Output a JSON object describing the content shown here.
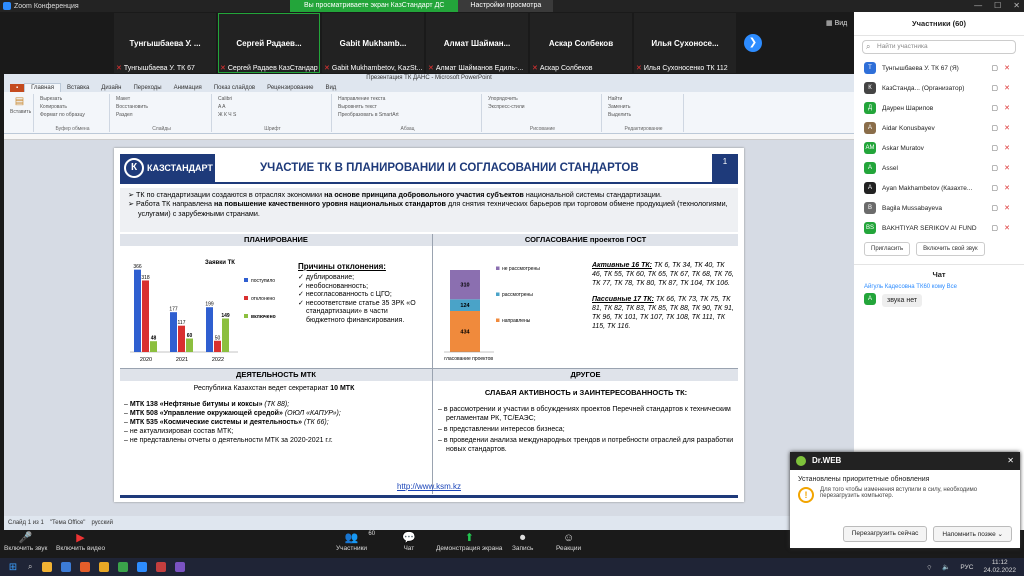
{
  "window": {
    "title": "Zoom Конференция",
    "share_banner": "Вы просматриваете экран КазСтандарт ДС",
    "view_options": "Настройки просмотра",
    "view_label": "Вид"
  },
  "strip": {
    "tiles": [
      {
        "name": "Тунгышбаева У. ...",
        "sub": "Тунгышбаева У. ТК 67"
      },
      {
        "name": "Сергей Радаев...",
        "sub": "Сергей Радаев КазСтандарт"
      },
      {
        "name": "Gabit Mukhamb...",
        "sub": "Gabit Mukhambetov, KazSt..."
      },
      {
        "name": "Алмат Шайман...",
        "sub": "Алмат Шайманов Едиль-..."
      },
      {
        "name": "Аскар Солбеков",
        "sub": "Аскар Солбеков"
      },
      {
        "name": "Илья Сухоносе...",
        "sub": "Илья Сухоносенко ТК 112"
      }
    ],
    "next_glyph": "❯"
  },
  "ppt": {
    "title": "Презентация ТК ДАНС - Microsoft PowerPoint",
    "tabs": [
      "Главная",
      "Вставка",
      "Дизайн",
      "Переходы",
      "Анимация",
      "Показ слайдов",
      "Рецензирование",
      "Вид"
    ],
    "groups": [
      {
        "label": "Буфер обмена",
        "items": [
          "Вырезать",
          "Копировать",
          "Формат по образцу"
        ]
      },
      {
        "label": "Слайды",
        "items": [
          "Макет",
          "Восстановить",
          "Раздел"
        ]
      },
      {
        "label": "Шрифт",
        "items": [
          "Calibri",
          "A A",
          "Ж К Ч S"
        ]
      },
      {
        "label": "Абзац",
        "items": [
          "Направление текста",
          "Выровнять текст",
          "Преобразовать в SmartArt"
        ]
      },
      {
        "label": "Рисование",
        "items": [
          "Упорядочить",
          "Экспресс-стили"
        ]
      },
      {
        "label": "Редактирование",
        "items": [
          "Найти",
          "Заменить",
          "Выделить"
        ]
      }
    ],
    "paste_label": "Вставить",
    "create_label": "Создать слайд",
    "status": [
      "Слайд 1 из 1",
      "\"Тема Office\"",
      "русский"
    ]
  },
  "slide": {
    "logo": "КАЗСТАНДАРТ",
    "logo_mark": "К",
    "title": "УЧАСТИЕ ТК В ПЛАНИРОВАНИИ И СОГЛАСОВАНИИ СТАНДАРТОВ",
    "num": "1",
    "intro": [
      {
        "a": "ТК по стандартизации создаются в отраслях экономики ",
        "b": "на основе принципа добровольного участия субъектов",
        "c": " национальной системы стандартизации."
      },
      {
        "a": "Работа ТК направлена ",
        "b": "на повышение качественного уровня национальных стандартов",
        "c": " для снятия технических барьеров при торговом обмене продукцией (технологиями, услугами) с зарубежными странами."
      }
    ],
    "plan_header": "ПЛАНИРОВАНИЕ",
    "gost_header": "СОГЛАСОВАНИЕ проектов ГОСТ",
    "mtk_header": "ДЕЯТЕЛЬНОСТЬ МТК",
    "other_header": "ДРУГОЕ",
    "reasons_title": "Причины отклонения:",
    "reasons": [
      "дублирование;",
      "необоснованность;",
      "несогласованность с ЦГО;",
      "несоответствие статье 35 ЗРК «О стандартизации» в части бюджетного финансирования."
    ],
    "active_title": "Активные 16 ТК:",
    "active_text": " ТК 6, ТК 34, ТК 40, ТК 46, ТК 55, ТК 60, ТК 65, ТК 67, ТК 68, ТК 76, ТК 77, ТК 78, ТК 80, ТК 87, ТК 104, ТК 106.",
    "passive_title": "Пассивные 17 ТК:",
    "passive_text": " ТК 66, ТК 73, ТК 75, ТК 81, ТК 82, ТК 83, ТК 85, ТК 88, ТК 90, ТК 91, ТК 96, ТК 101, ТК 107, ТК 108, ТК 111, ТК 115, ТК 116.",
    "mtk_intro": "Республика Казахстан ведет секретариат ",
    "mtk_intro_b": "10 МТК",
    "mtk_items": [
      {
        "b": "МТК 138 «Нефтяные битумы и коксы»",
        "i": " (ТК 88);"
      },
      {
        "b": "МТК 508 «Управление окружающей средой»",
        "i": " (ОЮЛ «КАПУР»);"
      },
      {
        "b": "МТК 535 «Космические системы и деятельность»",
        "i": " (ТК 66);"
      },
      {
        "b": "",
        "i": "не актуализирован состав МТК;"
      },
      {
        "b": "",
        "i": "не представлены отчеты о деятельности МТК за 2020-2021 г.г."
      }
    ],
    "other_title": "СЛАБАЯ АКТИВНОСТЬ и ЗАИНТЕРЕСОВАННОСТЬ ТК:",
    "other_items": [
      "в рассмотрении и участии в обсуждениях проектов Перечней стандартов к техническим регламентам РК, ТС/ЕАЭС;",
      "в представлении интересов бизнеса;",
      "в проведении анализа международных трендов и потребности отраслей для разработки новых стандартов."
    ],
    "link": "http://www.ksm.kz"
  },
  "chart_data": [
    {
      "type": "bar",
      "title": "Заявки ТК",
      "categories": [
        "2020",
        "2021",
        "2022"
      ],
      "series": [
        {
          "name": "поступило",
          "values": [
            366,
            177,
            199
          ]
        },
        {
          "name": "отклонено",
          "values": [
            318,
            117,
            50
          ]
        },
        {
          "name": "включено",
          "values": [
            48,
            60,
            149
          ]
        }
      ],
      "ylim": [
        0,
        400
      ],
      "colors": [
        "#2f5fd0",
        "#d93030",
        "#8cbf3f"
      ],
      "legend": "right"
    },
    {
      "type": "bar",
      "stacked": true,
      "xlabel": "согласование проектов",
      "series": [
        {
          "name": "направлены",
          "value": 434
        },
        {
          "name": "рассмотрены",
          "value": 124
        },
        {
          "name": "не рассмотрены",
          "value": 310
        }
      ],
      "colors": [
        "#f08a3c",
        "#4aa3c8",
        "#8b6fb0"
      ],
      "legend": "right"
    }
  ],
  "panel": {
    "title": "Участники (60)",
    "search_placeholder": "Найти участника",
    "participants": [
      {
        "init": "Т",
        "color": "#2f6fd8",
        "name": "Тунгышбаева У. ТК 67 (Я)"
      },
      {
        "init": "К",
        "color": "#444444",
        "name": "КазСтанда...  (Организатор)"
      },
      {
        "init": "Д",
        "color": "#23a53a",
        "name": "Даурен Шарипов"
      },
      {
        "init": "A",
        "color": "#8a6d4a",
        "name": "Aidar Konusbayev"
      },
      {
        "init": "AM",
        "color": "#23a53a",
        "name": "Askar Muratov"
      },
      {
        "init": "A",
        "color": "#23a53a",
        "name": "Assel"
      },
      {
        "init": "A",
        "color": "#222222",
        "name": "Ayan Makhambetov (Казахте..."
      },
      {
        "init": "B",
        "color": "#6b6b6b",
        "name": "Bagila Mussabayeva"
      },
      {
        "init": "BS",
        "color": "#23a53a",
        "name": "BAKHTIYAR SERIKOV AI FUND"
      }
    ],
    "invite": "Пригласить",
    "unmute": "Включить свой звук",
    "chat_title": "Чат",
    "chat_from": "Айгуль Кадесовна ТК60 кому Все",
    "chat_init": "A",
    "chat_msg": "звука нет"
  },
  "toolbar": [
    {
      "label": "Включить звук",
      "glyph": "🎤",
      "cls": "red"
    },
    {
      "label": "Включить видео",
      "glyph": "▶",
      "cls": "red"
    },
    {
      "label": "Участники",
      "glyph": "👥",
      "cls": "",
      "badge": "60"
    },
    {
      "label": "Чат",
      "glyph": "💬",
      "cls": ""
    },
    {
      "label": "Демонстрация экрана",
      "glyph": "⬆",
      "cls": "green"
    },
    {
      "label": "Запись",
      "glyph": "⏺",
      "cls": ""
    },
    {
      "label": "Реакции",
      "glyph": "☺",
      "cls": ""
    }
  ],
  "drweb": {
    "brand": "Dr.WEB",
    "title": "Установлены приоритетные обновления",
    "text": "Для того чтобы изменения вступили в силу, необходимо перезагрузить компьютер.",
    "restart": "Перезагрузить сейчас",
    "later": "Напомнить позже"
  },
  "taskbar": {
    "lang": "РУС",
    "time": "11:12",
    "date": "24.02.2022",
    "apps": [
      "#f2b233",
      "#3c7bd6",
      "#e35d2a",
      "#e9a825",
      "#3aa34a",
      "#2d8cff",
      "#c43e3e",
      "#7a53c2"
    ]
  }
}
